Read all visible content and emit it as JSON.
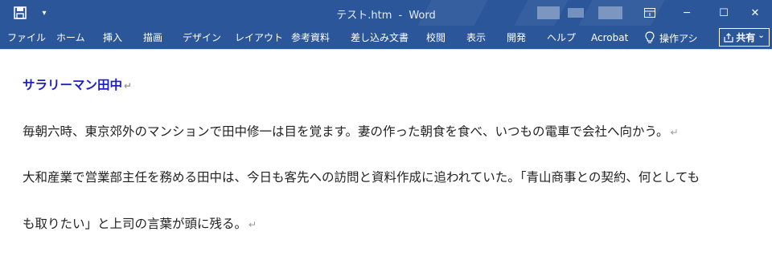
{
  "window": {
    "file_name": "テスト.htm",
    "separator": "-",
    "app_name": "Word",
    "dropdown_glyph": "▾",
    "minimize_glyph": "─",
    "maximize_glyph": "☐",
    "close_glyph": "✕"
  },
  "ribbon": {
    "tabs": [
      "ファイル",
      "ホーム",
      "挿入",
      "描画",
      "デザイン",
      "レイアウト",
      "参考資料",
      "差し込み文書",
      "校閲",
      "表示",
      "開発",
      "ヘルプ",
      "Acrobat"
    ],
    "tell_me_label": "操作アシ",
    "share_label": "共有",
    "share_chevron": "⌄"
  },
  "document": {
    "paragraph_mark": "↵",
    "heading": "サラリーマン田中",
    "line1": "毎朝六時、東京郊外のマンションで田中修一は目を覚ます。妻の作った朝食を食べ、いつもの電車で会社へ向かう。",
    "line2": "大和産業で営業部主任を務める田中は、今日も客先への訪問と資料作成に追われていた。「青山商事との契約、何としても",
    "line3": "も取りたい」と上司の言葉が頭に残る。"
  },
  "colors": {
    "title_bar": "#2b579a",
    "heading_text": "#1f1fc9",
    "body_text": "#222222",
    "paragraph_mark": "#9a9a9a"
  }
}
